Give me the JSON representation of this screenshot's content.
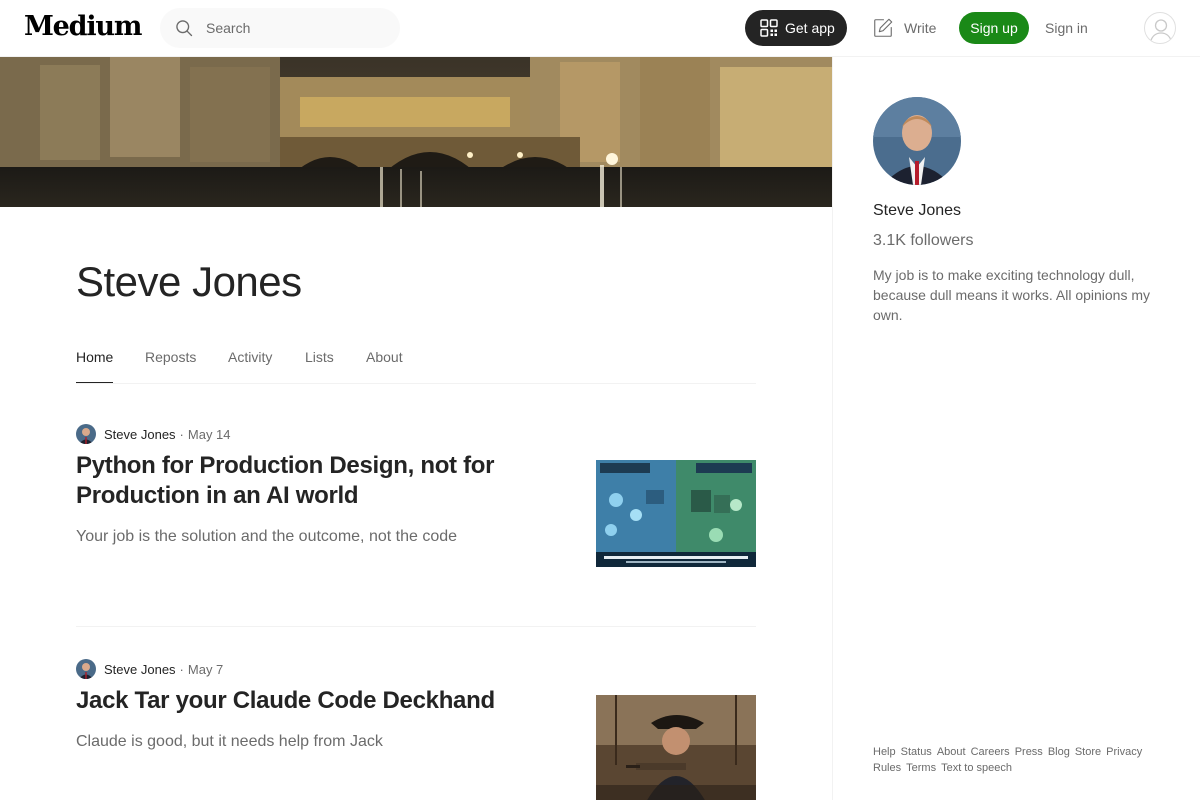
{
  "header": {
    "logo": "Medium",
    "search_placeholder": "Search",
    "get_app_label": "Get app",
    "write_label": "Write",
    "signup_label": "Sign up",
    "signin_label": "Sign in"
  },
  "profile": {
    "name": "Steve Jones",
    "tabs": [
      {
        "label": "Home",
        "active": true
      },
      {
        "label": "Repost",
        "active": false
      },
      {
        "label": "Activity",
        "active": false
      },
      {
        "label": "Lists",
        "active": false
      },
      {
        "label": "About",
        "active": false
      }
    ]
  },
  "posts": [
    {
      "author": "Steve Jones",
      "separator": "·",
      "date": "May 14",
      "title": "Python for Production Design, not for Production in an AI world",
      "subtitle": "Your job is the solution and the outcome, not the code"
    },
    {
      "author": "Steve Jones",
      "separator": "·",
      "date": "May 7",
      "title": "Jack Tar your Claude Code Deckhand",
      "subtitle": "Claude is good, but it needs help from Jack"
    }
  ],
  "sidebar": {
    "name": "Steve Jones",
    "followers": "3.1K followers",
    "bio": "My job is to make exciting technology dull, because dull means it works. All opinions my own."
  },
  "footer": {
    "links": [
      "Help",
      "Status",
      "About",
      "Careers",
      "Press",
      "Blog",
      "Store",
      "Privacy",
      "Rules",
      "Terms",
      "Text to speech"
    ]
  },
  "colors": {
    "accent_green": "#1a8917",
    "text_primary": "#242424",
    "text_secondary": "#6b6b6b",
    "get_app_bg": "#242424"
  }
}
